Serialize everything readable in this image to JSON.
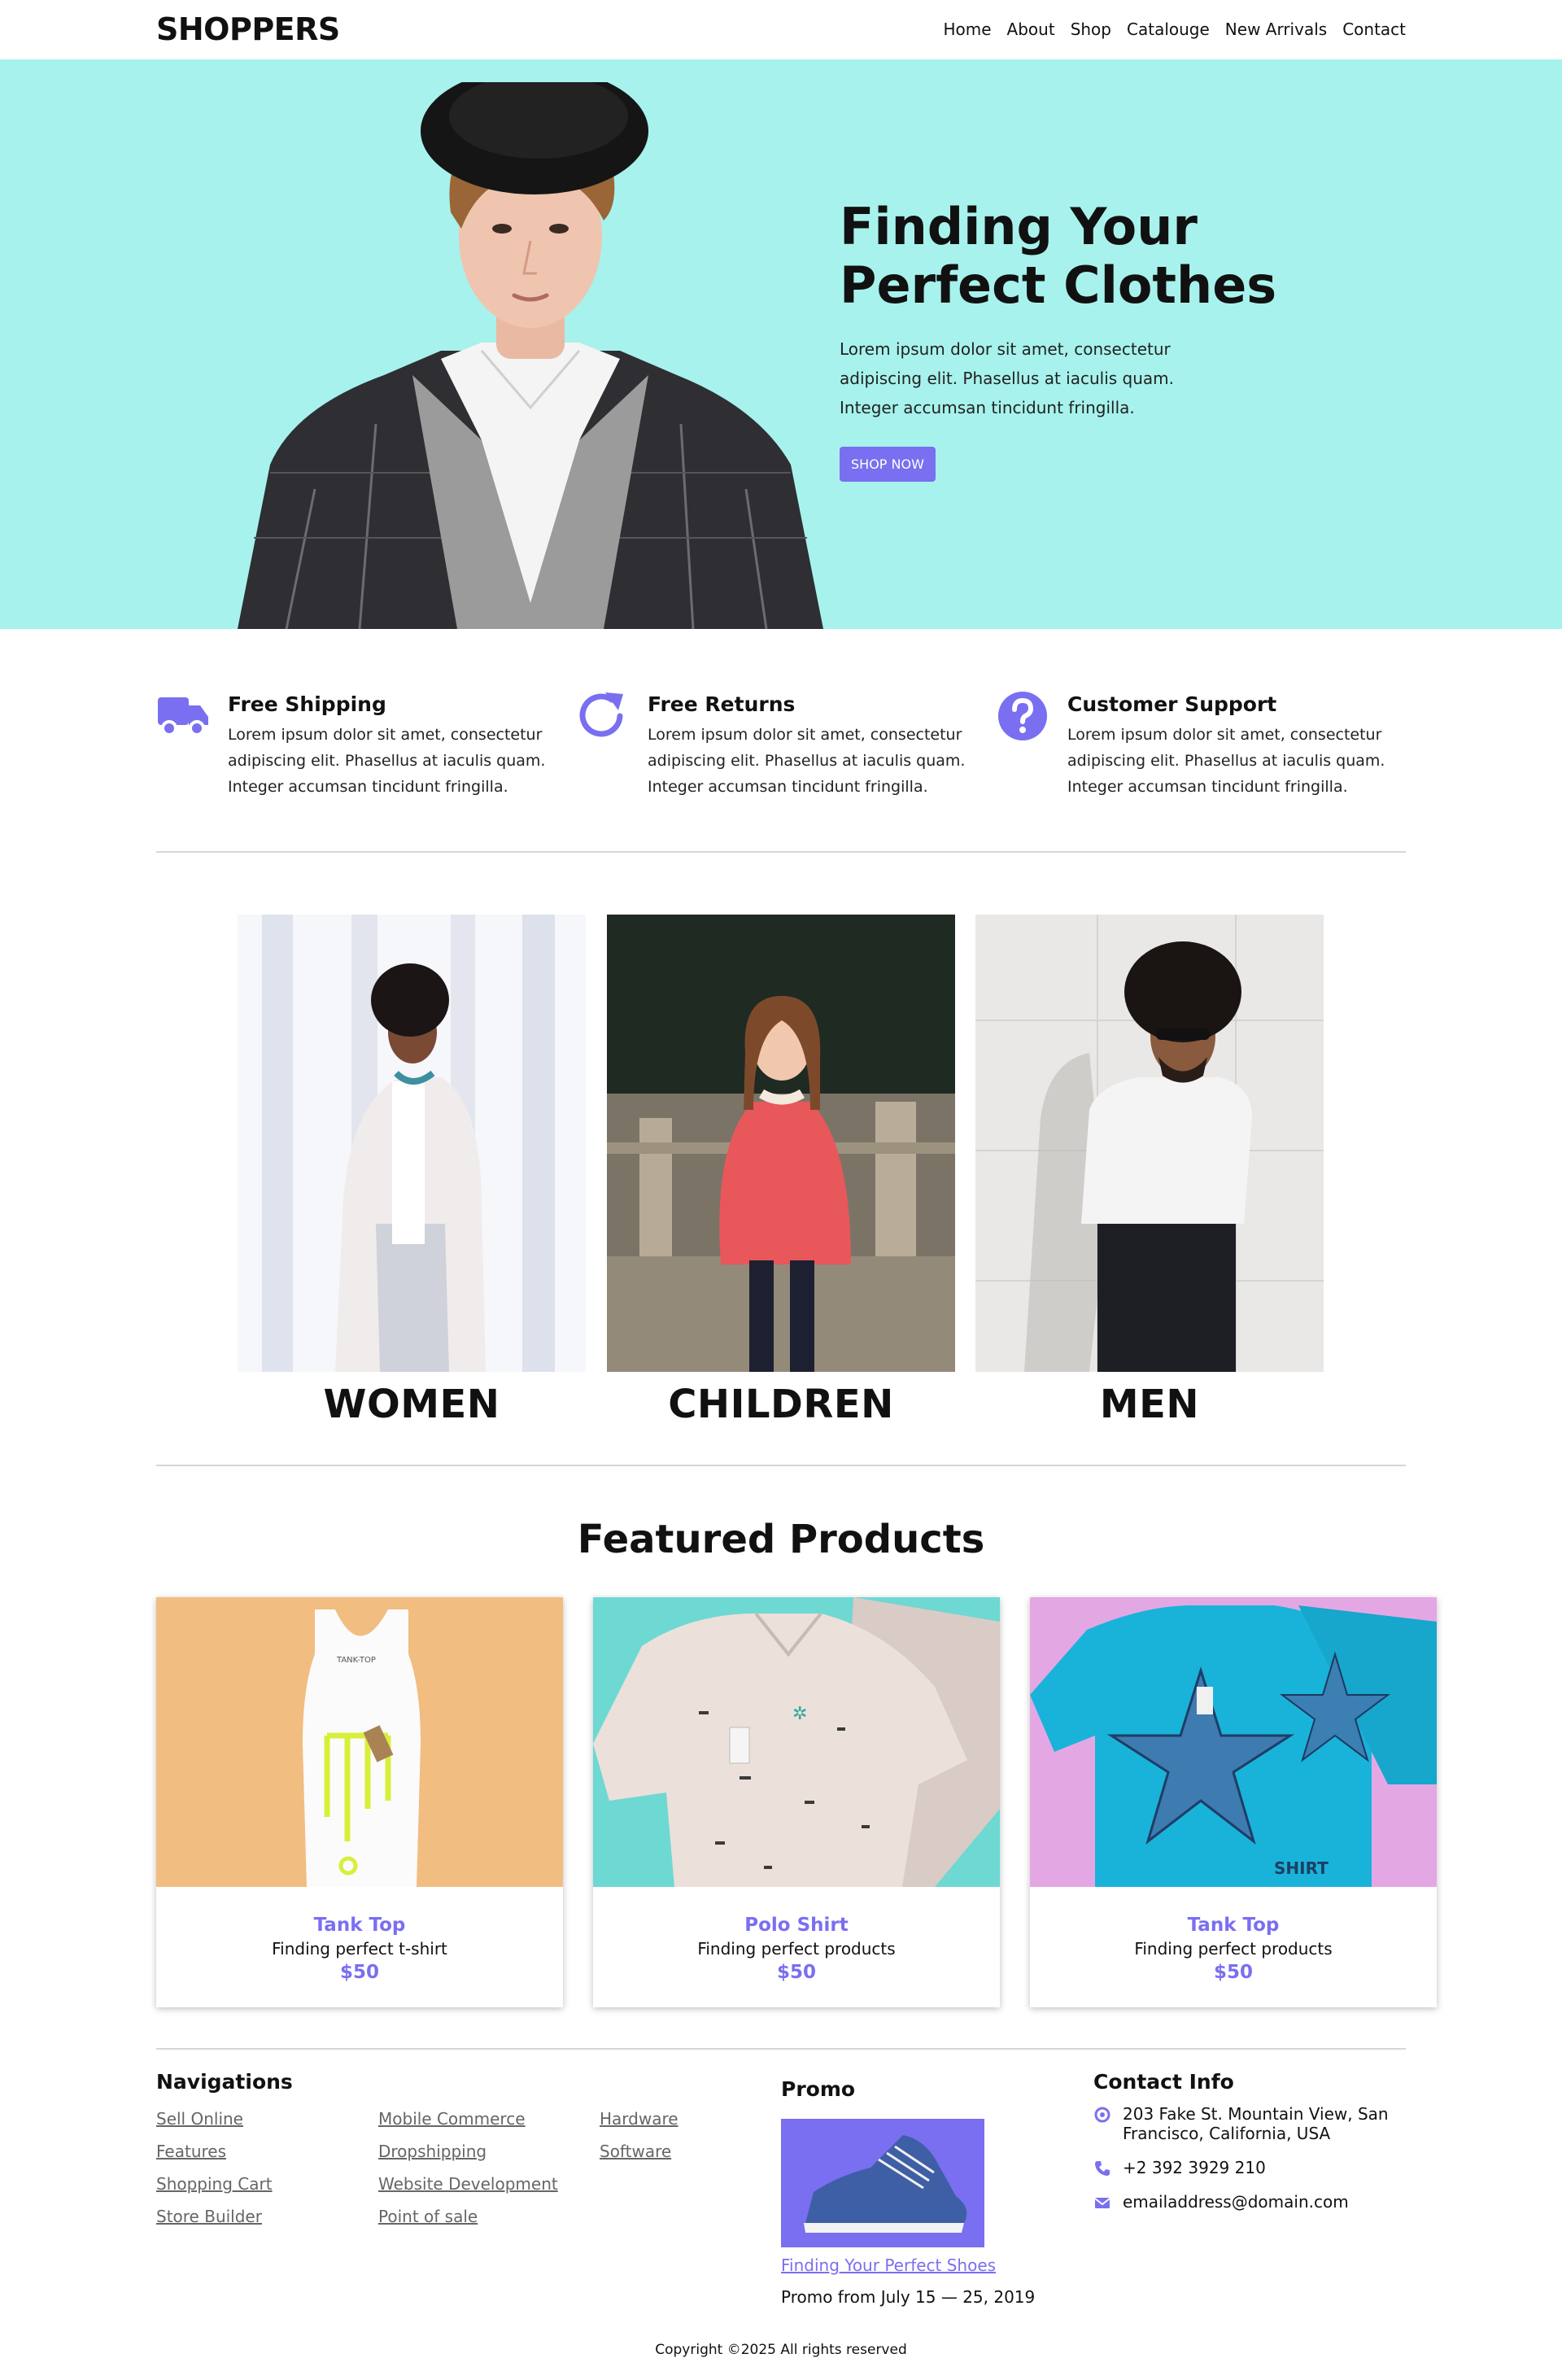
{
  "header": {
    "logo": "SHOPPERS",
    "nav": [
      "Home",
      "About",
      "Shop",
      "Catalouge",
      "New Arrivals",
      "Contact"
    ]
  },
  "hero": {
    "title_line1": "Finding Your",
    "title_line2": "Perfect Clothes",
    "description": "Lorem ipsum dolor sit amet, consectetur adipiscing elit. Phasellus at iaculis quam. Integer accumsan tincidunt fringilla.",
    "button": "SHOP NOW"
  },
  "features": [
    {
      "icon": "truck-icon",
      "title": "Free Shipping",
      "desc": "Lorem ipsum dolor sit amet, consectetur adipiscing elit. Phasellus at iaculis quam. Integer accumsan tincidunt fringilla."
    },
    {
      "icon": "refresh-icon",
      "title": "Free Returns",
      "desc": "Lorem ipsum dolor sit amet, consectetur adipiscing elit. Phasellus at iaculis quam. Integer accumsan tincidunt fringilla."
    },
    {
      "icon": "question-icon",
      "title": "Customer Support",
      "desc": "Lorem ipsum dolor sit amet, consectetur adipiscing elit. Phasellus at iaculis quam. Integer accumsan tincidunt fringilla."
    }
  ],
  "categories": [
    "WOMEN",
    "CHILDREN",
    "MEN"
  ],
  "featured": {
    "title": "Featured Products",
    "products": [
      {
        "name": "Tank Top",
        "desc": "Finding perfect t-shirt",
        "price": "$50"
      },
      {
        "name": "Polo Shirt",
        "desc": "Finding perfect products",
        "price": "$50"
      },
      {
        "name": "Tank Top",
        "desc": "Finding perfect products",
        "price": "$50"
      }
    ]
  },
  "footer": {
    "nav_title": "Navigations",
    "nav_col1": [
      "Sell Online",
      "Features",
      "Shopping Cart",
      "Store Builder"
    ],
    "nav_col2": [
      "Mobile Commerce",
      "Dropshipping",
      "Website Development",
      "Point of sale"
    ],
    "nav_col3": [
      "Hardware",
      "Software"
    ],
    "promo_title": "Promo",
    "promo_link": "Finding Your Perfect Shoes",
    "promo_date": "Promo from July 15 — 25, 2019",
    "contact_title": "Contact Info",
    "address": "203 Fake St. Mountain View, San Francisco, California, USA",
    "phone": "+2 392 3929 210",
    "email": "emailaddress@domain.com",
    "copyright": "Copyright ©2025 All rights reserved"
  },
  "colors": {
    "accent": "#7a6ff0",
    "hero_bg": "#a7f2ec"
  }
}
